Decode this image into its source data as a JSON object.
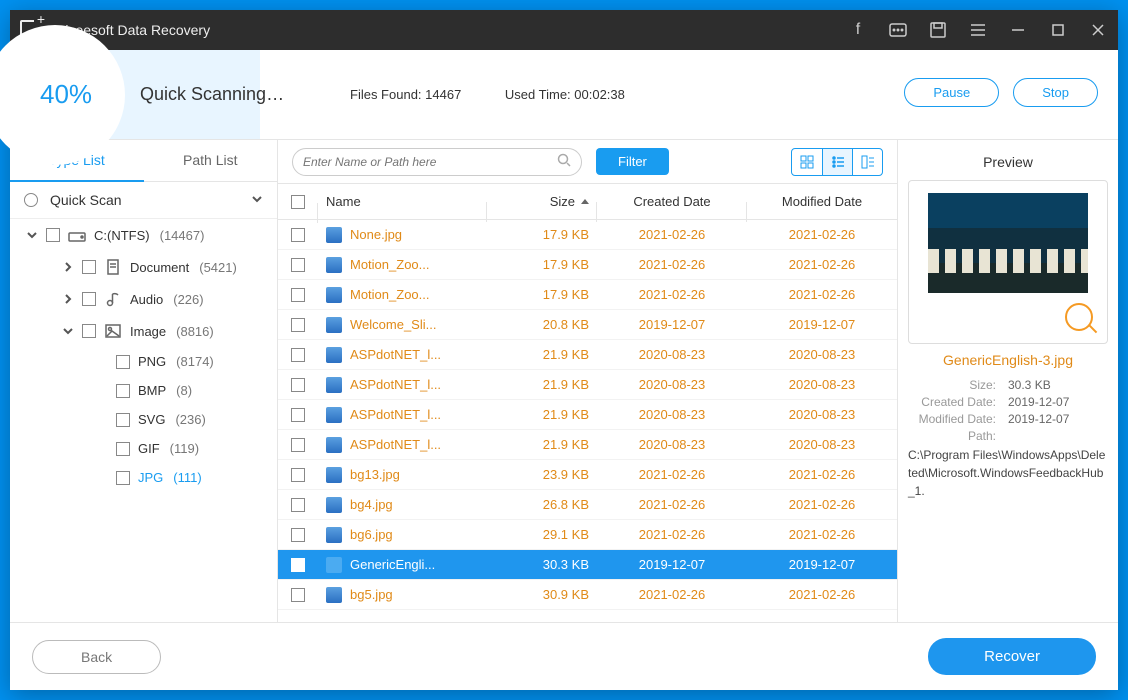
{
  "titlebar": {
    "title": "Aiseesoft Data Recovery"
  },
  "status": {
    "percent": "40%",
    "scan_text": "Quick Scanning…",
    "files_found": "Files Found: 14467",
    "used_time": "Used Time: 00:02:38",
    "pause": "Pause",
    "stop": "Stop"
  },
  "tabs": {
    "type_list": "Type List",
    "path_list": "Path List"
  },
  "quick_scan": {
    "label": "Quick Scan"
  },
  "tree": {
    "drive": {
      "label": "C:(NTFS)",
      "count": "(14467)"
    },
    "document": {
      "label": "Document",
      "count": "(5421)"
    },
    "audio": {
      "label": "Audio",
      "count": "(226)"
    },
    "image": {
      "label": "Image",
      "count": "(8816)"
    },
    "png": {
      "label": "PNG",
      "count": "(8174)"
    },
    "bmp": {
      "label": "BMP",
      "count": "(8)"
    },
    "svg": {
      "label": "SVG",
      "count": "(236)"
    },
    "gif": {
      "label": "GIF",
      "count": "(119)"
    },
    "jpg": {
      "label": "JPG",
      "count": "(111)"
    }
  },
  "toolbar": {
    "search_placeholder": "Enter Name or Path here",
    "filter": "Filter"
  },
  "columns": {
    "name": "Name",
    "size": "Size",
    "created": "Created Date",
    "modified": "Modified Date"
  },
  "rows": [
    {
      "name": "None.jpg",
      "size": "17.9 KB",
      "created": "2021-02-26",
      "modified": "2021-02-26",
      "selected": false
    },
    {
      "name": "Motion_Zoo...",
      "size": "17.9 KB",
      "created": "2021-02-26",
      "modified": "2021-02-26",
      "selected": false
    },
    {
      "name": "Motion_Zoo...",
      "size": "17.9 KB",
      "created": "2021-02-26",
      "modified": "2021-02-26",
      "selected": false
    },
    {
      "name": "Welcome_Sli...",
      "size": "20.8 KB",
      "created": "2019-12-07",
      "modified": "2019-12-07",
      "selected": false
    },
    {
      "name": "ASPdotNET_l...",
      "size": "21.9 KB",
      "created": "2020-08-23",
      "modified": "2020-08-23",
      "selected": false
    },
    {
      "name": "ASPdotNET_l...",
      "size": "21.9 KB",
      "created": "2020-08-23",
      "modified": "2020-08-23",
      "selected": false
    },
    {
      "name": "ASPdotNET_l...",
      "size": "21.9 KB",
      "created": "2020-08-23",
      "modified": "2020-08-23",
      "selected": false
    },
    {
      "name": "ASPdotNET_l...",
      "size": "21.9 KB",
      "created": "2020-08-23",
      "modified": "2020-08-23",
      "selected": false
    },
    {
      "name": "bg13.jpg",
      "size": "23.9 KB",
      "created": "2021-02-26",
      "modified": "2021-02-26",
      "selected": false
    },
    {
      "name": "bg4.jpg",
      "size": "26.8 KB",
      "created": "2021-02-26",
      "modified": "2021-02-26",
      "selected": false
    },
    {
      "name": "bg6.jpg",
      "size": "29.1 KB",
      "created": "2021-02-26",
      "modified": "2021-02-26",
      "selected": false
    },
    {
      "name": "GenericEngli...",
      "size": "30.3 KB",
      "created": "2019-12-07",
      "modified": "2019-12-07",
      "selected": true
    },
    {
      "name": "bg5.jpg",
      "size": "30.9 KB",
      "created": "2021-02-26",
      "modified": "2021-02-26",
      "selected": false
    }
  ],
  "preview": {
    "heading": "Preview",
    "filename": "GenericEnglish-3.jpg",
    "size_label": "Size:",
    "size": "30.3 KB",
    "created_label": "Created Date:",
    "created": "2019-12-07",
    "modified_label": "Modified Date:",
    "modified": "2019-12-07",
    "path_label": "Path:",
    "path": "C:\\Program Files\\WindowsApps\\Deleted\\Microsoft.WindowsFeedbackHub_1."
  },
  "footer": {
    "back": "Back",
    "recover": "Recover"
  }
}
